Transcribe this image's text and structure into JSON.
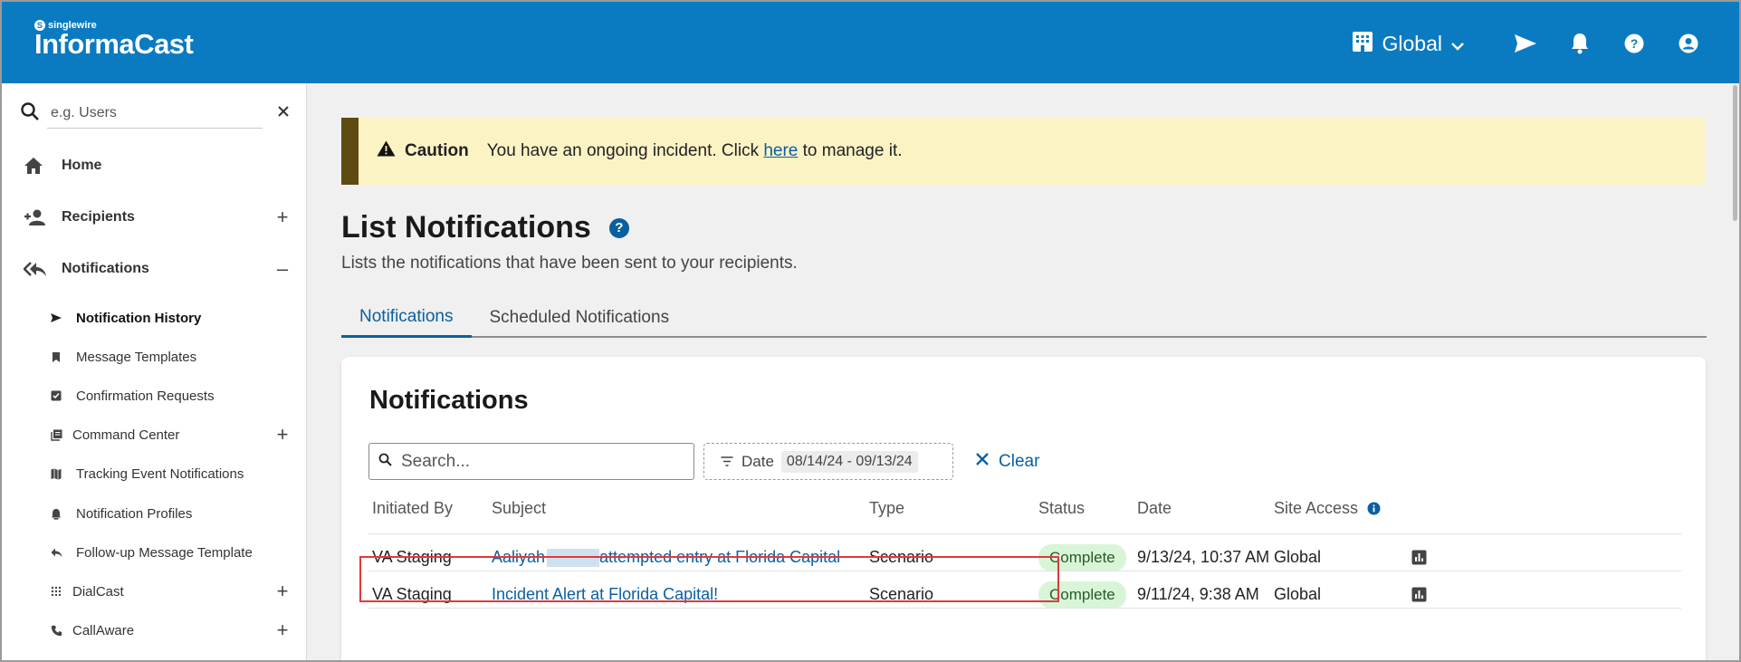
{
  "app": {
    "brand_small": "singlewire",
    "brand_name": "InformaCast"
  },
  "topbar": {
    "site_label": "Global",
    "icons": [
      "building-icon",
      "chevron-down-icon",
      "send-icon",
      "bell-icon",
      "help-icon",
      "account-icon"
    ]
  },
  "sidebar": {
    "search_placeholder": "e.g. Users",
    "items": [
      {
        "label": "Home",
        "icon": "home-icon"
      },
      {
        "label": "Recipients",
        "icon": "add-person-icon",
        "expand": "+"
      },
      {
        "label": "Notifications",
        "icon": "reply-all-icon",
        "expand": "–"
      }
    ],
    "sub_items": [
      {
        "label": "Notification History",
        "icon": "send-icon",
        "active": true
      },
      {
        "label": "Message Templates",
        "icon": "bookmark-icon"
      },
      {
        "label": "Confirmation Requests",
        "icon": "checkbox-icon"
      },
      {
        "label": "Command Center",
        "icon": "library-icon",
        "expand": "+"
      },
      {
        "label": "Tracking Event Notifications",
        "icon": "map-icon"
      },
      {
        "label": "Notification Profiles",
        "icon": "alarm-icon"
      },
      {
        "label": "Follow-up Message Template",
        "icon": "reply-icon"
      },
      {
        "label": "DialCast",
        "icon": "dialpad-icon",
        "expand": "+"
      },
      {
        "label": "CallAware",
        "icon": "phone-icon",
        "expand": "+"
      }
    ]
  },
  "caution": {
    "title": "Caution",
    "text_before": "You have an ongoing incident. Click ",
    "link": "here",
    "text_after": " to manage it."
  },
  "page": {
    "title": "List Notifications",
    "subtitle": "Lists the notifications that have been sent to your recipients.",
    "tabs": [
      "Notifications",
      "Scheduled Notifications"
    ],
    "active_tab": "Notifications"
  },
  "card": {
    "title": "Notifications",
    "search_placeholder": "Search...",
    "date_label": "Date",
    "date_value": "08/14/24 - 09/13/24",
    "clear_label": "Clear"
  },
  "table": {
    "columns": [
      "Initiated By",
      "Subject",
      "Type",
      "Status",
      "Date",
      "Site Access"
    ],
    "rows": [
      {
        "initiated_by": "VA Staging",
        "subject_first": "Aaliyah",
        "subject_rest": "attempted entry at Florida Capital",
        "type": "Scenario",
        "status": "Complete",
        "date": "9/13/24, 10:37 AM",
        "site_access": "Global"
      },
      {
        "initiated_by": "VA Staging",
        "subject_first": "Incident Alert at Florida Capital!",
        "subject_rest": "",
        "type": "Scenario",
        "status": "Complete",
        "date": "9/11/24, 9:38 AM",
        "site_access": "Global"
      }
    ]
  },
  "colors": {
    "topbar": "#0a7bc1",
    "link": "#0a5fa0",
    "caution_bg": "#fcf3c5",
    "caution_bar": "#5e4b12",
    "status_complete_bg": "#d8f5d8",
    "highlight": "#e0393c"
  }
}
